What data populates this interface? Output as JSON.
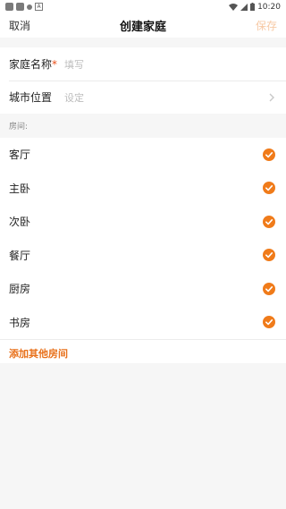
{
  "status_bar": {
    "time": "10:20"
  },
  "nav": {
    "cancel": "取消",
    "title": "创建家庭",
    "save": "保存"
  },
  "form": {
    "name_label": "家庭名称",
    "required_mark": "*",
    "name_placeholder": "填写",
    "city_label": "城市位置",
    "city_placeholder": "设定"
  },
  "rooms_section": {
    "label": "房间:"
  },
  "rooms": [
    {
      "label": "客厅",
      "checked": true
    },
    {
      "label": "主卧",
      "checked": true
    },
    {
      "label": "次卧",
      "checked": true
    },
    {
      "label": "餐厅",
      "checked": true
    },
    {
      "label": "厨房",
      "checked": true
    },
    {
      "label": "书房",
      "checked": true
    }
  ],
  "add_room": {
    "label": "添加其他房间"
  },
  "colors": {
    "accent": "#f07b1a",
    "save_disabled": "#f7c9a4",
    "background": "#f6f6f6"
  }
}
